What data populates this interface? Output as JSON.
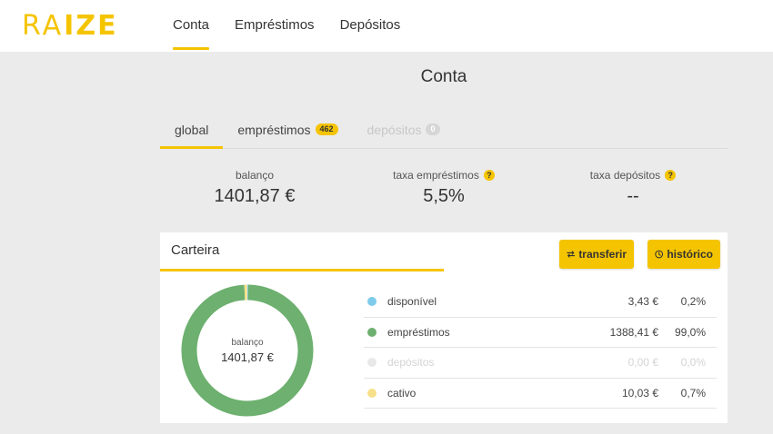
{
  "logo": {
    "part1": "RA",
    "part2": "IZE"
  },
  "nav": {
    "items": [
      {
        "label": "Conta"
      },
      {
        "label": "Empréstimos"
      },
      {
        "label": "Depósitos"
      }
    ]
  },
  "page": {
    "title": "Conta"
  },
  "tabs": {
    "global": "global",
    "emprestimos": "empréstimos",
    "emprestimos_count": "462",
    "depositos": "depósitos",
    "depositos_count": "0"
  },
  "stats": {
    "balanco_label": "balanço",
    "balanco_value": "1401,87 €",
    "taxa_emprestimos_label": "taxa empréstimos",
    "taxa_emprestimos_value": "5,5%",
    "taxa_depositos_label": "taxa depósitos",
    "taxa_depositos_value": "--",
    "help_glyph": "?"
  },
  "card": {
    "title": "Carteira",
    "transferir_label": "transferir",
    "historico_label": "histórico",
    "donut_label": "balanço",
    "donut_value": "1401,87 €"
  },
  "legend": [
    {
      "name": "disponível",
      "amount": "3,43 €",
      "pct": "0,2%",
      "color": "#7ecbea",
      "fraction": 0.002,
      "disabled": false
    },
    {
      "name": "empréstimos",
      "amount": "1388,41 €",
      "pct": "99,0%",
      "color": "#6db06f",
      "fraction": 0.99,
      "disabled": false
    },
    {
      "name": "depósitos",
      "amount": "0,00 €",
      "pct": "0,0%",
      "color": "#e8e8e8",
      "fraction": 0.0,
      "disabled": true
    },
    {
      "name": "cativo",
      "amount": "10,03 €",
      "pct": "0,7%",
      "color": "#f7e08a",
      "fraction": 0.007,
      "disabled": false
    }
  ],
  "colors": {
    "accent": "#f5c400",
    "page_bg": "#ebebeb"
  }
}
